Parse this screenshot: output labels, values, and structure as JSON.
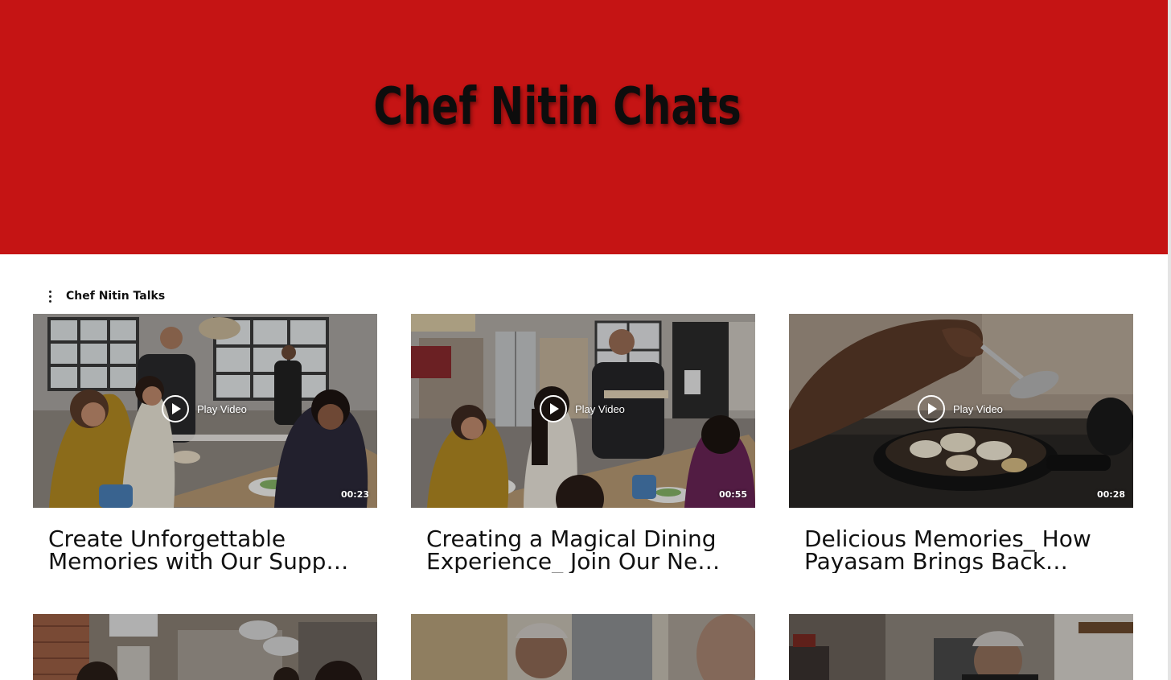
{
  "banner": {
    "title": "Chef Nitin Chats",
    "color": "#c51414"
  },
  "section": {
    "title": "Chef Nitin Talks",
    "menu_icon": "kebab-menu-icon"
  },
  "videos": [
    {
      "title": "Create Unforgettable Memories with Our Supper Club",
      "title_display": "Create Unforgettable Memories with Our Supp…",
      "play_label": "Play Video",
      "duration": "00:23"
    },
    {
      "title": "Creating a Magical Dining Experience_ Join Our New",
      "title_display": "Creating a Magical Dining Experience_ Join Our Ne…",
      "play_label": "Play Video",
      "duration": "00:55"
    },
    {
      "title": "Delicious Memories_ How Payasam Brings Back",
      "title_display": "Delicious Memories_ How Payasam Brings Back…",
      "play_label": "Play Video",
      "duration": "00:28"
    }
  ]
}
